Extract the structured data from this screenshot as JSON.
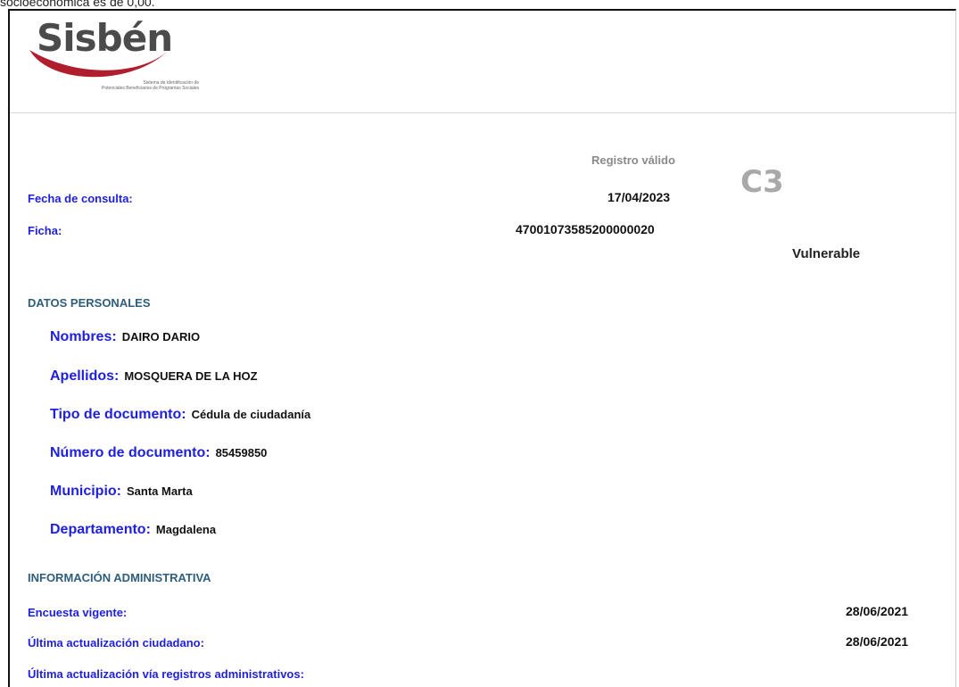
{
  "top_text": "socioeconómica es de 0,00.",
  "logo": {
    "wordmark": "Sisbén",
    "tagline_line1": "Sistema de Identificación de",
    "tagline_line2": "Potenciales Beneficiarios de Programas Sociales"
  },
  "status": {
    "registro": "Registro válido",
    "grupo": "C3",
    "clasificacion": "Vulnerable"
  },
  "consulta": {
    "fecha_label": "Fecha de consulta:",
    "fecha_value": "17/04/2023",
    "ficha_label": "Ficha:",
    "ficha_value": "47001073585200000020"
  },
  "personal": {
    "title": "DATOS PERSONALES",
    "fields": [
      {
        "label": "Nombres:",
        "value": "DAIRO DARIO"
      },
      {
        "label": "Apellidos:",
        "value": "MOSQUERA DE LA HOZ"
      },
      {
        "label": "Tipo de documento:",
        "value": "Cédula de ciudadanía"
      },
      {
        "label": "Número de documento:",
        "value": "85459850"
      },
      {
        "label": "Municipio:",
        "value": "Santa Marta"
      },
      {
        "label": "Departamento:",
        "value": "Magdalena"
      }
    ]
  },
  "admin": {
    "title": "INFORMACIÓN ADMINISTRATIVA",
    "rows": [
      {
        "label": "Encuesta vigente:",
        "value": "28/06/2021"
      },
      {
        "label": "Última actualización ciudadano:",
        "value": "28/06/2021"
      },
      {
        "label": "Última actualización vía registros administrativos:",
        "value": ""
      }
    ]
  },
  "colors": {
    "label_blue": "#1f1fe0",
    "section_blue": "#2f5d7c",
    "logo_red": "#b01e2e",
    "logo_gray": "#4b4b4b"
  }
}
